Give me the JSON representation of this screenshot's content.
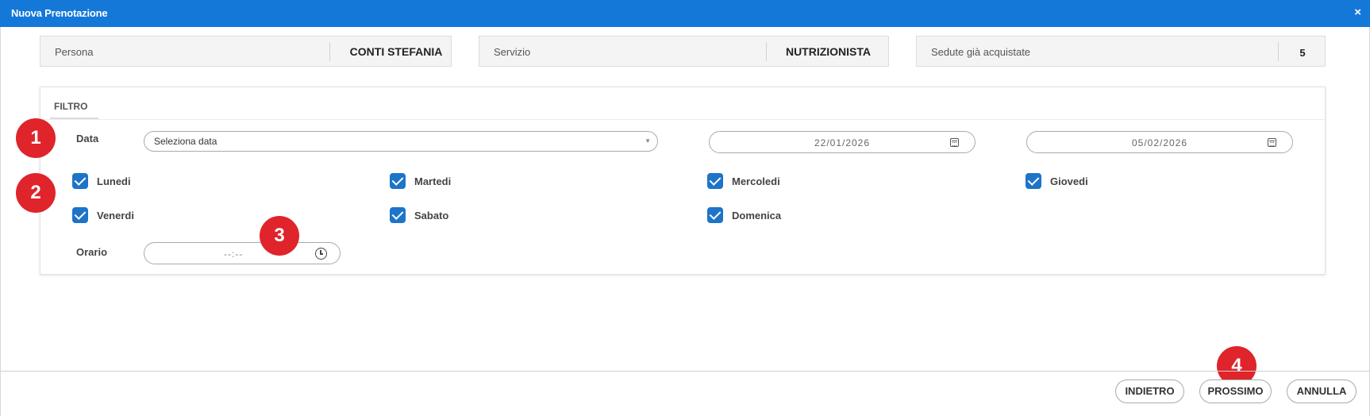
{
  "window": {
    "title": "Nuova Prenotazione",
    "close_symbol": "×"
  },
  "info": {
    "persona": {
      "label": "Persona",
      "value": "CONTI STEFANIA"
    },
    "servizio": {
      "label": "Servizio",
      "value": "NUTRIZIONISTA"
    },
    "sedute": {
      "label": "Sedute già acquistate",
      "value": "5"
    }
  },
  "filter": {
    "title": "FILTRO",
    "data_label": "Data",
    "select_value": "Seleziona data",
    "date_from": "22/01/2026",
    "date_to": "05/02/2026",
    "days": [
      {
        "label": "Lunedi",
        "checked": true
      },
      {
        "label": "Martedi",
        "checked": true
      },
      {
        "label": "Mercoledi",
        "checked": true
      },
      {
        "label": "Giovedi",
        "checked": true
      },
      {
        "label": "Venerdi",
        "checked": true
      },
      {
        "label": "Sabato",
        "checked": true
      },
      {
        "label": "Domenica",
        "checked": true
      }
    ],
    "orario_label": "Orario",
    "time_value": "--:--"
  },
  "annotations": [
    "1",
    "2",
    "3",
    "4"
  ],
  "footer": {
    "back": "INDIETRO",
    "next": "PROSSIMO",
    "cancel": "ANNULLA"
  },
  "colors": {
    "titlebar": "#1378d8",
    "checkbox": "#1d74c8",
    "badge": "#e0242b"
  },
  "icons": {
    "close": "close-icon",
    "calendar": "calendar-icon",
    "clock": "clock-icon",
    "dropdown": "chevron-down-icon"
  }
}
